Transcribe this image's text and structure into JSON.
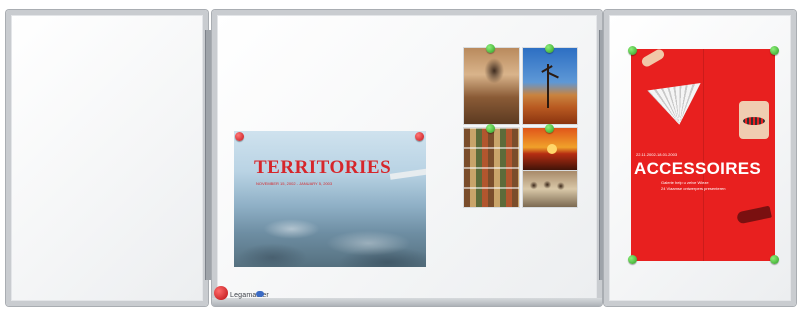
{
  "scene": {
    "description_type": "photo",
    "board": {
      "frame_color": "#c9ccd0",
      "surface_color": "#ffffff"
    },
    "tray": {
      "label": "Legamaster"
    },
    "poster_territories": {
      "title": "TERRITORIES",
      "subtitle": "NOVEMBER 15, 2002 - JANUARY 5, 2003",
      "footer": "",
      "accent_color": "#d6262b"
    },
    "poster_accessoires": {
      "title": "ACCESSOIRES",
      "date_line": "22.11.2002-18.01.2003",
      "line1": "Galerie help u zelve Wieze",
      "line2": "24 Vlaamse ontwerpers presenteren",
      "small_text": "",
      "accent_color": "#e8201f"
    },
    "magnets": {
      "colors": [
        "#c4151b",
        "#2f9d22"
      ]
    }
  }
}
